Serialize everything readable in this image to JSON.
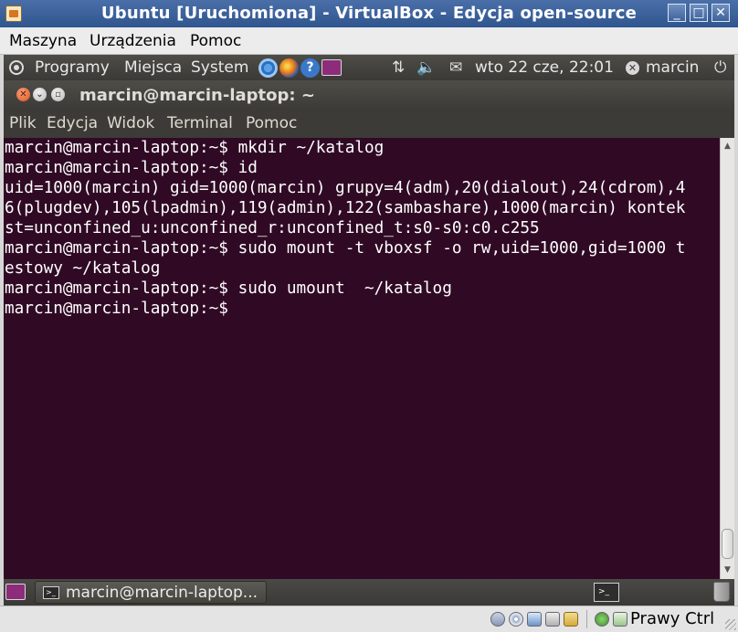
{
  "vbox": {
    "title": "Ubuntu [Uruchomiona] - VirtualBox - Edycja open-source",
    "menu": [
      "Maszyna",
      "Urządzenia",
      "Pomoc"
    ],
    "host_key_label": "Prawy Ctrl"
  },
  "top_panel": {
    "menus": [
      "Programy",
      "Miejsca",
      "System"
    ],
    "launchers": [
      "chromium-icon",
      "firefox-icon",
      "help-icon",
      "terminal-icon"
    ],
    "clock": "wto 22 cze, 22:01",
    "user": "marcin"
  },
  "terminal": {
    "title": "marcin@marcin-laptop: ~",
    "menu": [
      "Plik",
      "Edycja",
      "Widok",
      "Terminal",
      "Pomoc"
    ],
    "lines": [
      "marcin@marcin-laptop:~$ mkdir ~/katalog",
      "marcin@marcin-laptop:~$ id",
      "uid=1000(marcin) gid=1000(marcin) grupy=4(adm),20(dialout),24(cdrom),4",
      "6(plugdev),105(lpadmin),119(admin),122(sambashare),1000(marcin) kontek",
      "st=unconfined_u:unconfined_r:unconfined_t:s0-s0:c0.c255",
      "marcin@marcin-laptop:~$ sudo mount -t vboxsf -o rw,uid=1000,gid=1000 t",
      "estowy ~/katalog",
      "marcin@marcin-laptop:~$ sudo umount  ~/katalog",
      "marcin@marcin-laptop:~$ "
    ]
  },
  "bottom_panel": {
    "task_label": "marcin@marcin-laptop..."
  },
  "colors": {
    "terminal_bg": "#300a24",
    "panel_bg": "#3c3b37",
    "vbox_title_bg": "#2f558f"
  }
}
